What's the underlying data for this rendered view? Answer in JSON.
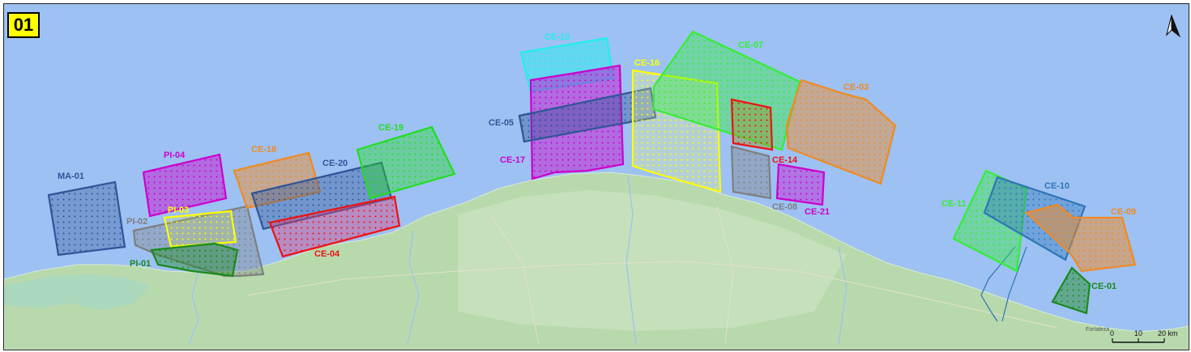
{
  "map": {
    "badge": "01",
    "colors": {
      "ocean": "#9dc1f3",
      "land": "#b7d9ac",
      "land_light": "#cfe5c3",
      "lagoon": "#a8d7c0"
    },
    "north_arrow_icon": "north-arrow-icon",
    "scale_bar": {
      "labels": [
        "0",
        "10",
        "20 km"
      ]
    },
    "town_label": "Fortaleza",
    "blocks": [
      {
        "id": "ma-01",
        "label": "MA-01",
        "color": "#2f5597",
        "fill": "rgba(47,85,151,0.35)"
      },
      {
        "id": "pi-04",
        "label": "PI-04",
        "color": "#cc00cc",
        "fill": "rgba(204,0,204,0.45)"
      },
      {
        "id": "pi-02",
        "label": "PI-02",
        "color": "#7f7f7f",
        "fill": "rgba(127,127,127,0.35)"
      },
      {
        "id": "pi-03",
        "label": "PI-03",
        "color": "#ffff00",
        "fill": "rgba(255,255,0,0.15)"
      },
      {
        "id": "pi-01",
        "label": "PI-01",
        "color": "#1a8a1a",
        "fill": "rgba(26,138,26,0.40)"
      },
      {
        "id": "ce-18",
        "label": "CE-18",
        "color": "#f08a24",
        "fill": "rgba(240,138,36,0.45)"
      },
      {
        "id": "ce-20",
        "label": "CE-20",
        "color": "#2f5597",
        "fill": "rgba(47,85,151,0.40)"
      },
      {
        "id": "ce-04",
        "label": "CE-04",
        "color": "#ee1111",
        "fill": "rgba(220,60,120,0.40)"
      },
      {
        "id": "ce-19",
        "label": "CE-19",
        "color": "#22dd22",
        "fill": "rgba(34,221,34,0.40)"
      },
      {
        "id": "ce-13",
        "label": "CE-13",
        "color": "#22eeee",
        "fill": "rgba(34,238,238,0.45)"
      },
      {
        "id": "ce-17",
        "label": "CE-17",
        "color": "#cc00cc",
        "fill": "rgba(204,0,204,0.45)"
      },
      {
        "id": "ce-05",
        "label": "CE-05",
        "color": "#2f5597",
        "fill": "rgba(47,85,151,0.40)"
      },
      {
        "id": "ce-16",
        "label": "CE-16",
        "color": "#ffff00",
        "fill": "rgba(255,255,120,0.25)"
      },
      {
        "id": "ce-07",
        "label": "CE-07",
        "color": "#33ee33",
        "fill": "rgba(51,238,51,0.40)"
      },
      {
        "id": "ce-14",
        "label": "CE-14",
        "color": "#ee1111",
        "fill": "rgba(150,150,40,0.45)"
      },
      {
        "id": "ce-08",
        "label": "CE-08",
        "color": "#7f7f7f",
        "fill": "rgba(127,127,127,0.40)"
      },
      {
        "id": "ce-21",
        "label": "CE-21",
        "color": "#cc00cc",
        "fill": "rgba(204,0,204,0.40)"
      },
      {
        "id": "ce-03",
        "label": "CE-03",
        "color": "#f08a24",
        "fill": "rgba(240,138,36,0.45)"
      },
      {
        "id": "ce-11",
        "label": "CE-11",
        "color": "#33ee33",
        "fill": "rgba(51,238,51,0.40)"
      },
      {
        "id": "ce-10",
        "label": "CE-10",
        "color": "#2e75b6",
        "fill": "rgba(46,117,182,0.40)"
      },
      {
        "id": "ce-09",
        "label": "CE-09",
        "color": "#f08a24",
        "fill": "rgba(240,138,36,0.50)"
      },
      {
        "id": "ce-01",
        "label": "CE-01",
        "color": "#1a8a1a",
        "fill": "rgba(26,138,26,0.45)"
      }
    ]
  }
}
